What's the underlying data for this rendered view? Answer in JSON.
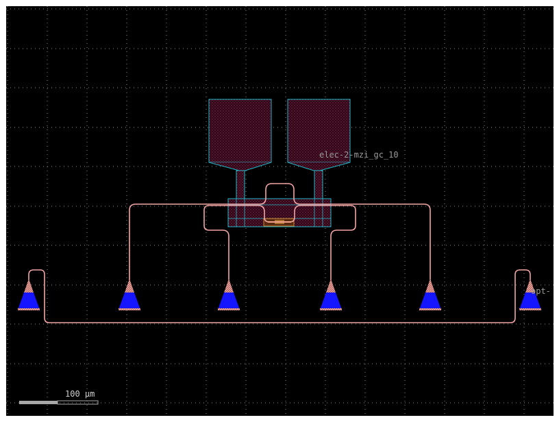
{
  "labels": {
    "elec_port": "elec-2-mzi_gc_10",
    "opt_port": "opt-"
  },
  "scale_bar": {
    "text": "100 μm"
  },
  "colors": {
    "background": "#000000",
    "grid": "#8a8a8a",
    "waveguide": "#f4a6a6",
    "pad_fill": "#3a0f26",
    "pad_outline": "#1fb7c9",
    "coupler_fill": "#1515ff",
    "coupler_tip": "#f08a8a",
    "heater": "#e8a040"
  },
  "icons": {
    "grating_coupler": "triangle-grating-icon",
    "bond_pad": "square-pad-icon"
  }
}
